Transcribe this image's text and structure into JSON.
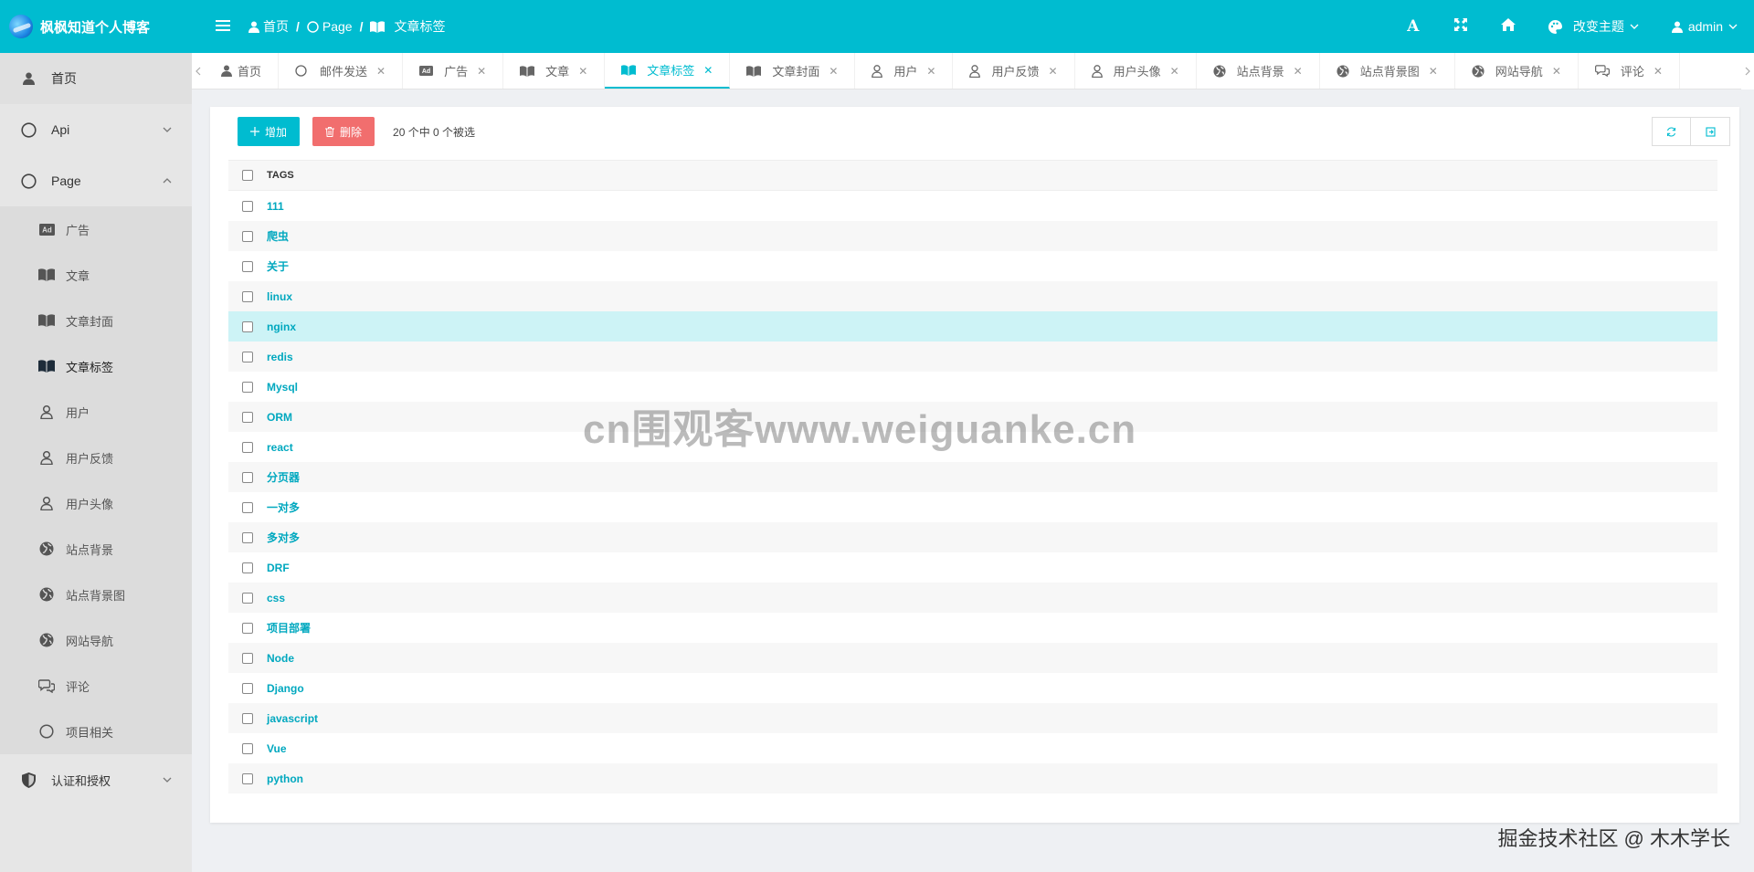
{
  "brand": {
    "title": "枫枫知道个人博客"
  },
  "breadcrumb": [
    {
      "label": "首页",
      "icon": "user-icon"
    },
    {
      "label": "Page",
      "icon": "circle-icon"
    },
    {
      "label": "文章标签",
      "icon": "book-icon"
    }
  ],
  "header": {
    "font_icon": "A",
    "theme_label": "改变主题",
    "user_label": "admin"
  },
  "sidebar": {
    "home": "首页",
    "api": "Api",
    "page": "Page",
    "items": [
      {
        "label": "广告",
        "icon": "ad-icon"
      },
      {
        "label": "文章",
        "icon": "book-icon"
      },
      {
        "label": "文章封面",
        "icon": "book-icon"
      },
      {
        "label": "文章标签",
        "icon": "book-icon",
        "active": true
      },
      {
        "label": "用户",
        "icon": "user-icon"
      },
      {
        "label": "用户反馈",
        "icon": "user-icon"
      },
      {
        "label": "用户头像",
        "icon": "user-icon"
      },
      {
        "label": "站点背景",
        "icon": "globe-icon"
      },
      {
        "label": "站点背景图",
        "icon": "globe-icon"
      },
      {
        "label": "网站导航",
        "icon": "globe-icon"
      },
      {
        "label": "评论",
        "icon": "comments-icon"
      },
      {
        "label": "项目相关",
        "icon": "circle-icon"
      }
    ],
    "auth": "认证和授权"
  },
  "tabs": [
    {
      "label": "首页",
      "closable": false
    },
    {
      "label": "邮件发送",
      "closable": true
    },
    {
      "label": "广告",
      "closable": true
    },
    {
      "label": "文章",
      "closable": true
    },
    {
      "label": "文章标签",
      "closable": true,
      "active": true
    },
    {
      "label": "文章封面",
      "closable": true
    },
    {
      "label": "用户",
      "closable": true
    },
    {
      "label": "用户反馈",
      "closable": true
    },
    {
      "label": "用户头像",
      "closable": true
    },
    {
      "label": "站点背景",
      "closable": true
    },
    {
      "label": "站点背景图",
      "closable": true
    },
    {
      "label": "网站导航",
      "closable": true
    },
    {
      "label": "评论",
      "closable": true
    }
  ],
  "toolbar": {
    "add_label": "增加",
    "delete_label": "删除",
    "selection_text": "20 个中 0 个被选"
  },
  "table": {
    "header": "TAGS",
    "rows": [
      "111",
      "爬虫",
      "关于",
      "linux",
      "nginx",
      "redis",
      "Mysql",
      "ORM",
      "react",
      "分页器",
      "一对多",
      "多对多",
      "DRF",
      "css",
      "项目部署",
      "Node",
      "Django",
      "javascript",
      "Vue",
      "python"
    ],
    "highlighted_row": 4
  },
  "overlay": {
    "watermark": "cn围观客www.weiguanke.cn",
    "juejin": "掘金技术社区 @ 木木学长"
  },
  "colors": {
    "primary": "#00bcd0",
    "danger": "#f16e6e",
    "highlight": "#cdf3f6"
  }
}
